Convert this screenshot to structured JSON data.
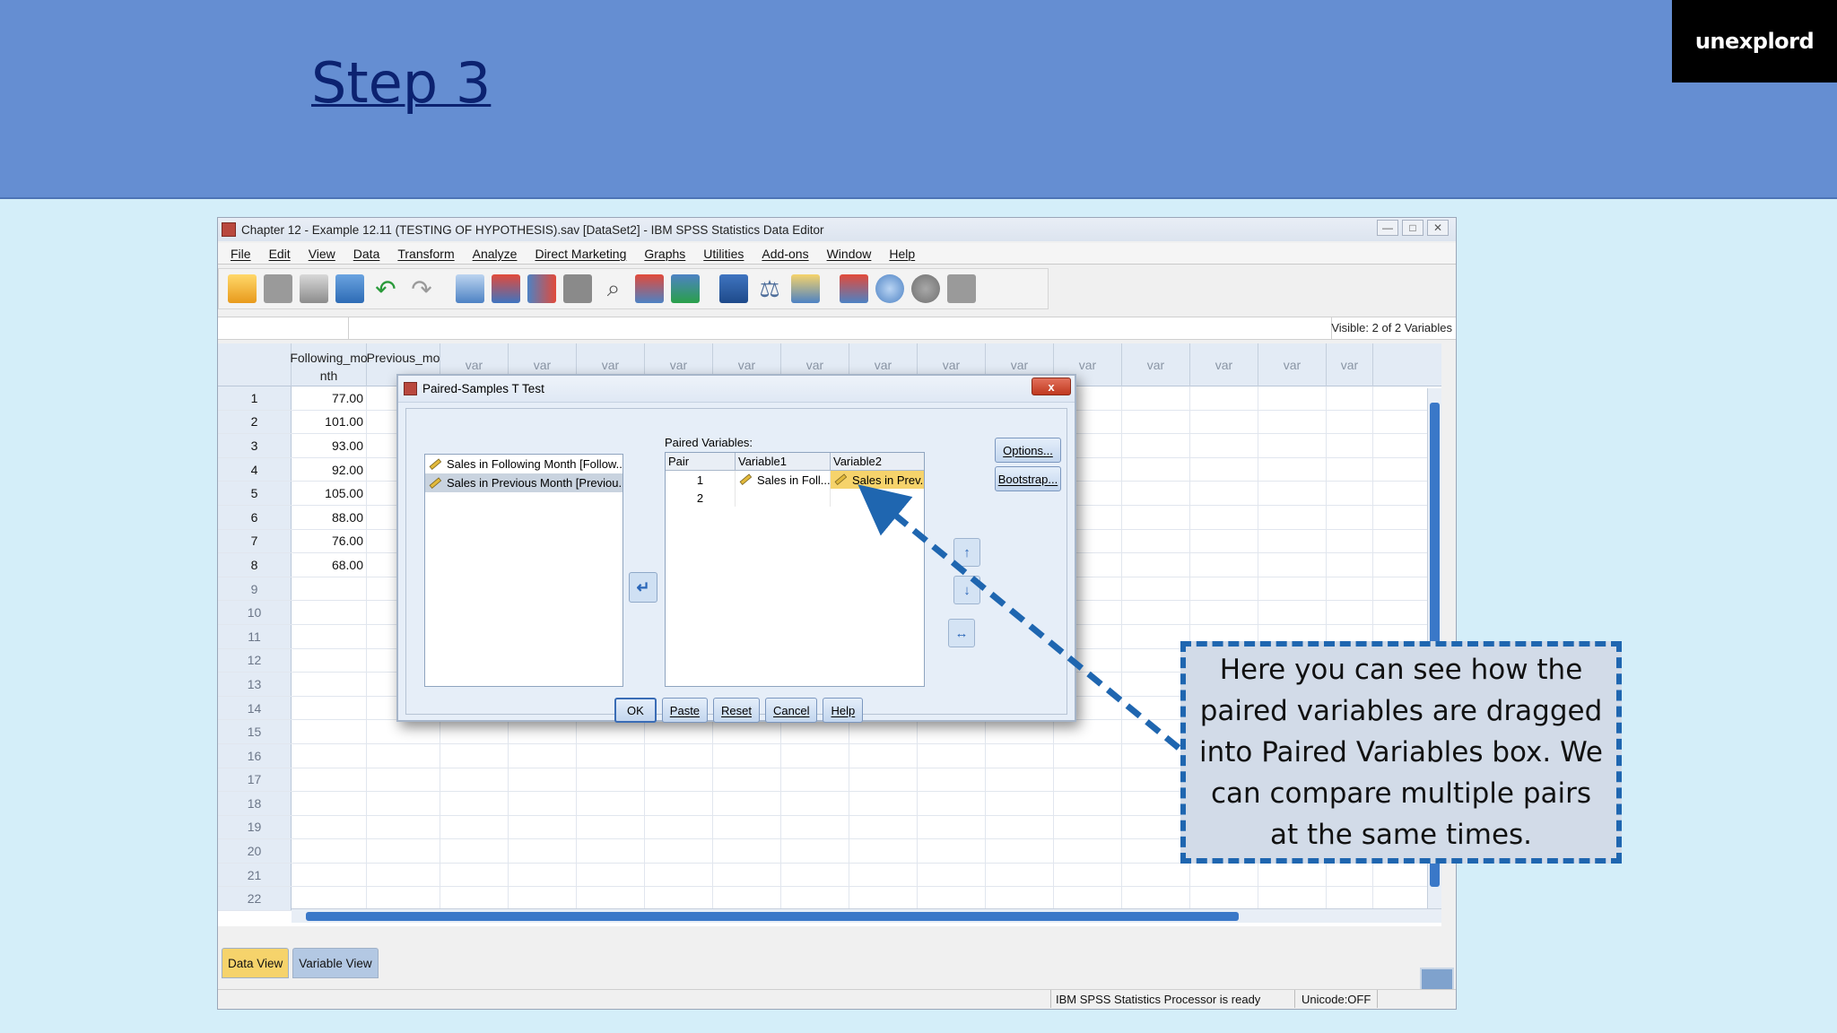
{
  "slide": {
    "title": "Step 3",
    "logo": "unexplord"
  },
  "window": {
    "title": "Chapter 12 - Example 12.11 (TESTING OF HYPOTHESIS).sav [DataSet2] - IBM SPSS Statistics Data Editor",
    "controls": [
      "—",
      "□",
      "✕"
    ]
  },
  "menu": [
    "File",
    "Edit",
    "View",
    "Data",
    "Transform",
    "Analyze",
    "Direct Marketing",
    "Graphs",
    "Utilities",
    "Add-ons",
    "Window",
    "Help"
  ],
  "cellbar": {
    "visible": "Visible: 2 of 2 Variables"
  },
  "grid": {
    "columns": [
      "Following_mo nth",
      "Previous_mo",
      "var",
      "var",
      "var",
      "var",
      "var",
      "var",
      "var",
      "var",
      "var",
      "var",
      "var",
      "var",
      "var",
      "var"
    ],
    "row_numbers": [
      "1",
      "2",
      "3",
      "4",
      "5",
      "6",
      "7",
      "8",
      "9",
      "10",
      "11",
      "12",
      "13",
      "14",
      "15",
      "16",
      "17",
      "18",
      "19",
      "20",
      "21",
      "22"
    ],
    "following_values": [
      "77.00",
      "101.00",
      "93.00",
      "92.00",
      "105.00",
      "88.00",
      "76.00",
      "68.00"
    ]
  },
  "tabs": {
    "data_view": "Data View",
    "variable_view": "Variable View"
  },
  "status": {
    "ready": "IBM SPSS Statistics Processor is ready",
    "unicode": "Unicode:OFF"
  },
  "dialog": {
    "title": "Paired-Samples T Test",
    "close": "x",
    "source_items": [
      "Sales in Following Month [Follow...",
      "Sales in Previous Month [Previou..."
    ],
    "paired_label": "Paired Variables:",
    "table_headers": [
      "Pair",
      "Variable1",
      "Variable2"
    ],
    "rows": [
      {
        "pair": "1",
        "var1": "Sales in Foll...",
        "var2": "Sales in Prev..."
      },
      {
        "pair": "2",
        "var1": "",
        "var2": ""
      }
    ],
    "buttons": {
      "options": "Options...",
      "bootstrap": "Bootstrap...",
      "ok": "OK",
      "paste": "Paste",
      "reset": "Reset",
      "cancel": "Cancel",
      "help": "Help"
    }
  },
  "callout": {
    "text": "Here you can see how the paired variables are dragged into Paired Variables box. We can compare multiple pairs at the same times."
  },
  "colors": {
    "header_band": "#658ed2",
    "slide_bg": "#d4eef9",
    "highlight": "#f6d36b",
    "callout_border": "#1f66b0"
  }
}
